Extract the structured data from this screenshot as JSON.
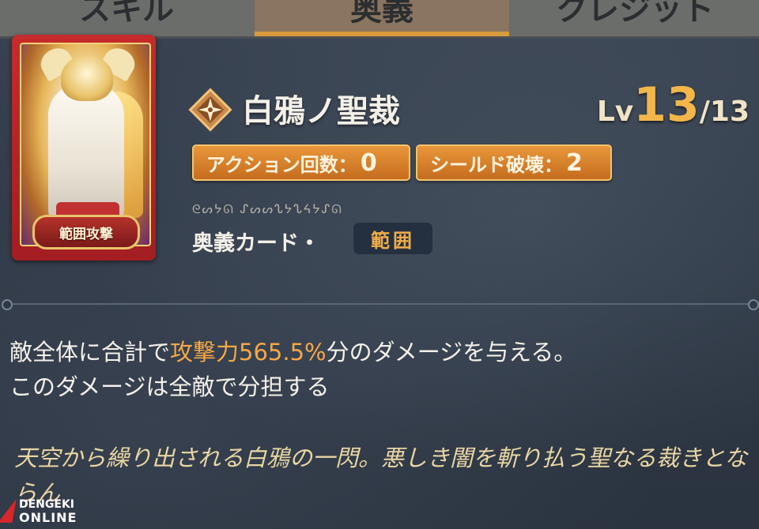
{
  "tabs": [
    {
      "label": "スキル"
    },
    {
      "label": "奥義"
    },
    {
      "label": "クレジット"
    }
  ],
  "card": {
    "badge": "範囲攻撃"
  },
  "skill": {
    "name": "白鴉ノ聖裁",
    "level_prefix": "Lv",
    "level_current": "13",
    "level_max": "/13",
    "stats": [
      {
        "label": "アクション回数：",
        "value": "0"
      },
      {
        "label": "シールド破壊：",
        "value": "2"
      }
    ],
    "runes": "ᘓᔕᔭᘏ ᔑᔕᔕᔐᔭᔐᔦᔭᔑᘏ",
    "card_type": "奥義カード・",
    "type_badge": "範囲"
  },
  "description": {
    "before": "敵全体に合計で",
    "highlight": "攻撃力565.5%",
    "after": "分のダメージを与える。",
    "line2": "このダメージは全敵で分担する"
  },
  "flavor": "天空から繰り出される白鴉の一閃。悪しき闇を斬り払う聖なる裁きとならん",
  "watermark": {
    "brand": "DENGEKI",
    "sub": "ONLINE"
  },
  "colors": {
    "accent": "#f2b64a",
    "highlight": "#f5a847",
    "pill": "#d9822c",
    "card_frame": "#c62b2b"
  }
}
